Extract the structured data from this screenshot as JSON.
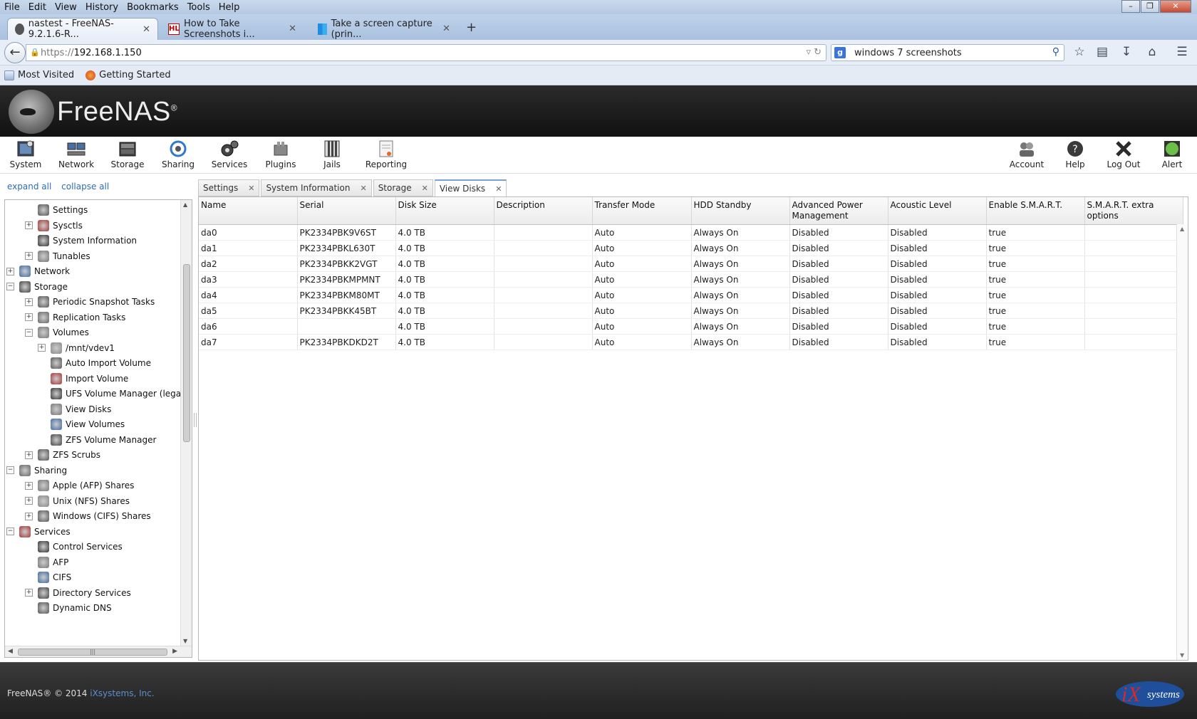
{
  "browser": {
    "menu": [
      "File",
      "Edit",
      "View",
      "History",
      "Bookmarks",
      "Tools",
      "Help"
    ],
    "tabs": [
      {
        "label": "nastest - FreeNAS-9.2.1.6-R...",
        "active": true
      },
      {
        "label": "How to Take Screenshots i...",
        "active": false
      },
      {
        "label": "Take a screen capture (prin...",
        "active": false
      }
    ],
    "new_tab": "+",
    "url_scheme": "https://",
    "url_host": "192.168.1.150",
    "search_value": "windows 7 screenshots",
    "bookmarks": [
      "Most Visited",
      "Getting Started"
    ]
  },
  "app": {
    "brand": "FreeNAS",
    "toolbar_left": [
      "System",
      "Network",
      "Storage",
      "Sharing",
      "Services",
      "Plugins",
      "Jails",
      "Reporting"
    ],
    "toolbar_right": [
      "Account",
      "Help",
      "Log Out",
      "Alert"
    ]
  },
  "tree": {
    "expand_all": "expand all",
    "collapse_all": "collapse all",
    "nodes": [
      {
        "label": "Settings",
        "level": 1,
        "exp": ""
      },
      {
        "label": "Sysctls",
        "level": 1,
        "exp": "+"
      },
      {
        "label": "System Information",
        "level": 1,
        "exp": ""
      },
      {
        "label": "Tunables",
        "level": 1,
        "exp": "+"
      },
      {
        "label": "Network",
        "level": 0,
        "exp": "+"
      },
      {
        "label": "Storage",
        "level": 0,
        "exp": "−"
      },
      {
        "label": "Periodic Snapshot Tasks",
        "level": 1,
        "exp": "+"
      },
      {
        "label": "Replication Tasks",
        "level": 1,
        "exp": "+"
      },
      {
        "label": "Volumes",
        "level": 1,
        "exp": "−"
      },
      {
        "label": "/mnt/vdev1",
        "level": 2,
        "exp": "+"
      },
      {
        "label": "Auto Import Volume",
        "level": 2,
        "exp": ""
      },
      {
        "label": "Import Volume",
        "level": 2,
        "exp": ""
      },
      {
        "label": "UFS Volume Manager (legacy)",
        "level": 2,
        "exp": ""
      },
      {
        "label": "View Disks",
        "level": 2,
        "exp": ""
      },
      {
        "label": "View Volumes",
        "level": 2,
        "exp": ""
      },
      {
        "label": "ZFS Volume Manager",
        "level": 2,
        "exp": ""
      },
      {
        "label": "ZFS Scrubs",
        "level": 1,
        "exp": "+"
      },
      {
        "label": "Sharing",
        "level": 0,
        "exp": "−"
      },
      {
        "label": "Apple (AFP) Shares",
        "level": 1,
        "exp": "+"
      },
      {
        "label": "Unix (NFS) Shares",
        "level": 1,
        "exp": "+"
      },
      {
        "label": "Windows (CIFS) Shares",
        "level": 1,
        "exp": "+"
      },
      {
        "label": "Services",
        "level": 0,
        "exp": "−"
      },
      {
        "label": "Control Services",
        "level": 1,
        "exp": ""
      },
      {
        "label": "AFP",
        "level": 1,
        "exp": ""
      },
      {
        "label": "CIFS",
        "level": 1,
        "exp": ""
      },
      {
        "label": "Directory Services",
        "level": 1,
        "exp": "+"
      },
      {
        "label": "Dynamic DNS",
        "level": 1,
        "exp": ""
      }
    ]
  },
  "content_tabs": [
    "Settings",
    "System Information",
    "Storage",
    "View Disks"
  ],
  "active_content_tab": "View Disks",
  "disks": {
    "columns": [
      "Name",
      "Serial",
      "Disk Size",
      "Description",
      "Transfer Mode",
      "HDD Standby",
      "Advanced Power Management",
      "Acoustic Level",
      "Enable S.M.A.R.T.",
      "S.M.A.R.T. extra options"
    ],
    "rows": [
      [
        "da0",
        "PK2334PBK9V6ST",
        "4.0 TB",
        "",
        "Auto",
        "Always On",
        "Disabled",
        "Disabled",
        "true",
        ""
      ],
      [
        "da1",
        "PK2334PBKL630T",
        "4.0 TB",
        "",
        "Auto",
        "Always On",
        "Disabled",
        "Disabled",
        "true",
        ""
      ],
      [
        "da2",
        "PK2334PBKK2VGT",
        "4.0 TB",
        "",
        "Auto",
        "Always On",
        "Disabled",
        "Disabled",
        "true",
        ""
      ],
      [
        "da3",
        "PK2334PBKMPMNT",
        "4.0 TB",
        "",
        "Auto",
        "Always On",
        "Disabled",
        "Disabled",
        "true",
        ""
      ],
      [
        "da4",
        "PK2334PBKM80MT",
        "4.0 TB",
        "",
        "Auto",
        "Always On",
        "Disabled",
        "Disabled",
        "true",
        ""
      ],
      [
        "da5",
        "PK2334PBKK45BT",
        "4.0 TB",
        "",
        "Auto",
        "Always On",
        "Disabled",
        "Disabled",
        "true",
        ""
      ],
      [
        "da6",
        "",
        "4.0 TB",
        "",
        "Auto",
        "Always On",
        "Disabled",
        "Disabled",
        "true",
        ""
      ],
      [
        "da7",
        "PK2334PBKDKD2T",
        "4.0 TB",
        "",
        "Auto",
        "Always On",
        "Disabled",
        "Disabled",
        "true",
        ""
      ]
    ]
  },
  "footer": {
    "copyright": "FreeNAS® © 2014 ",
    "company": "iXsystems, Inc.",
    "logo_text": "systems"
  },
  "colors": {
    "link": "#2f6db4",
    "alert_green": "#6cc04a",
    "header_dark": "#1c1c1c"
  }
}
